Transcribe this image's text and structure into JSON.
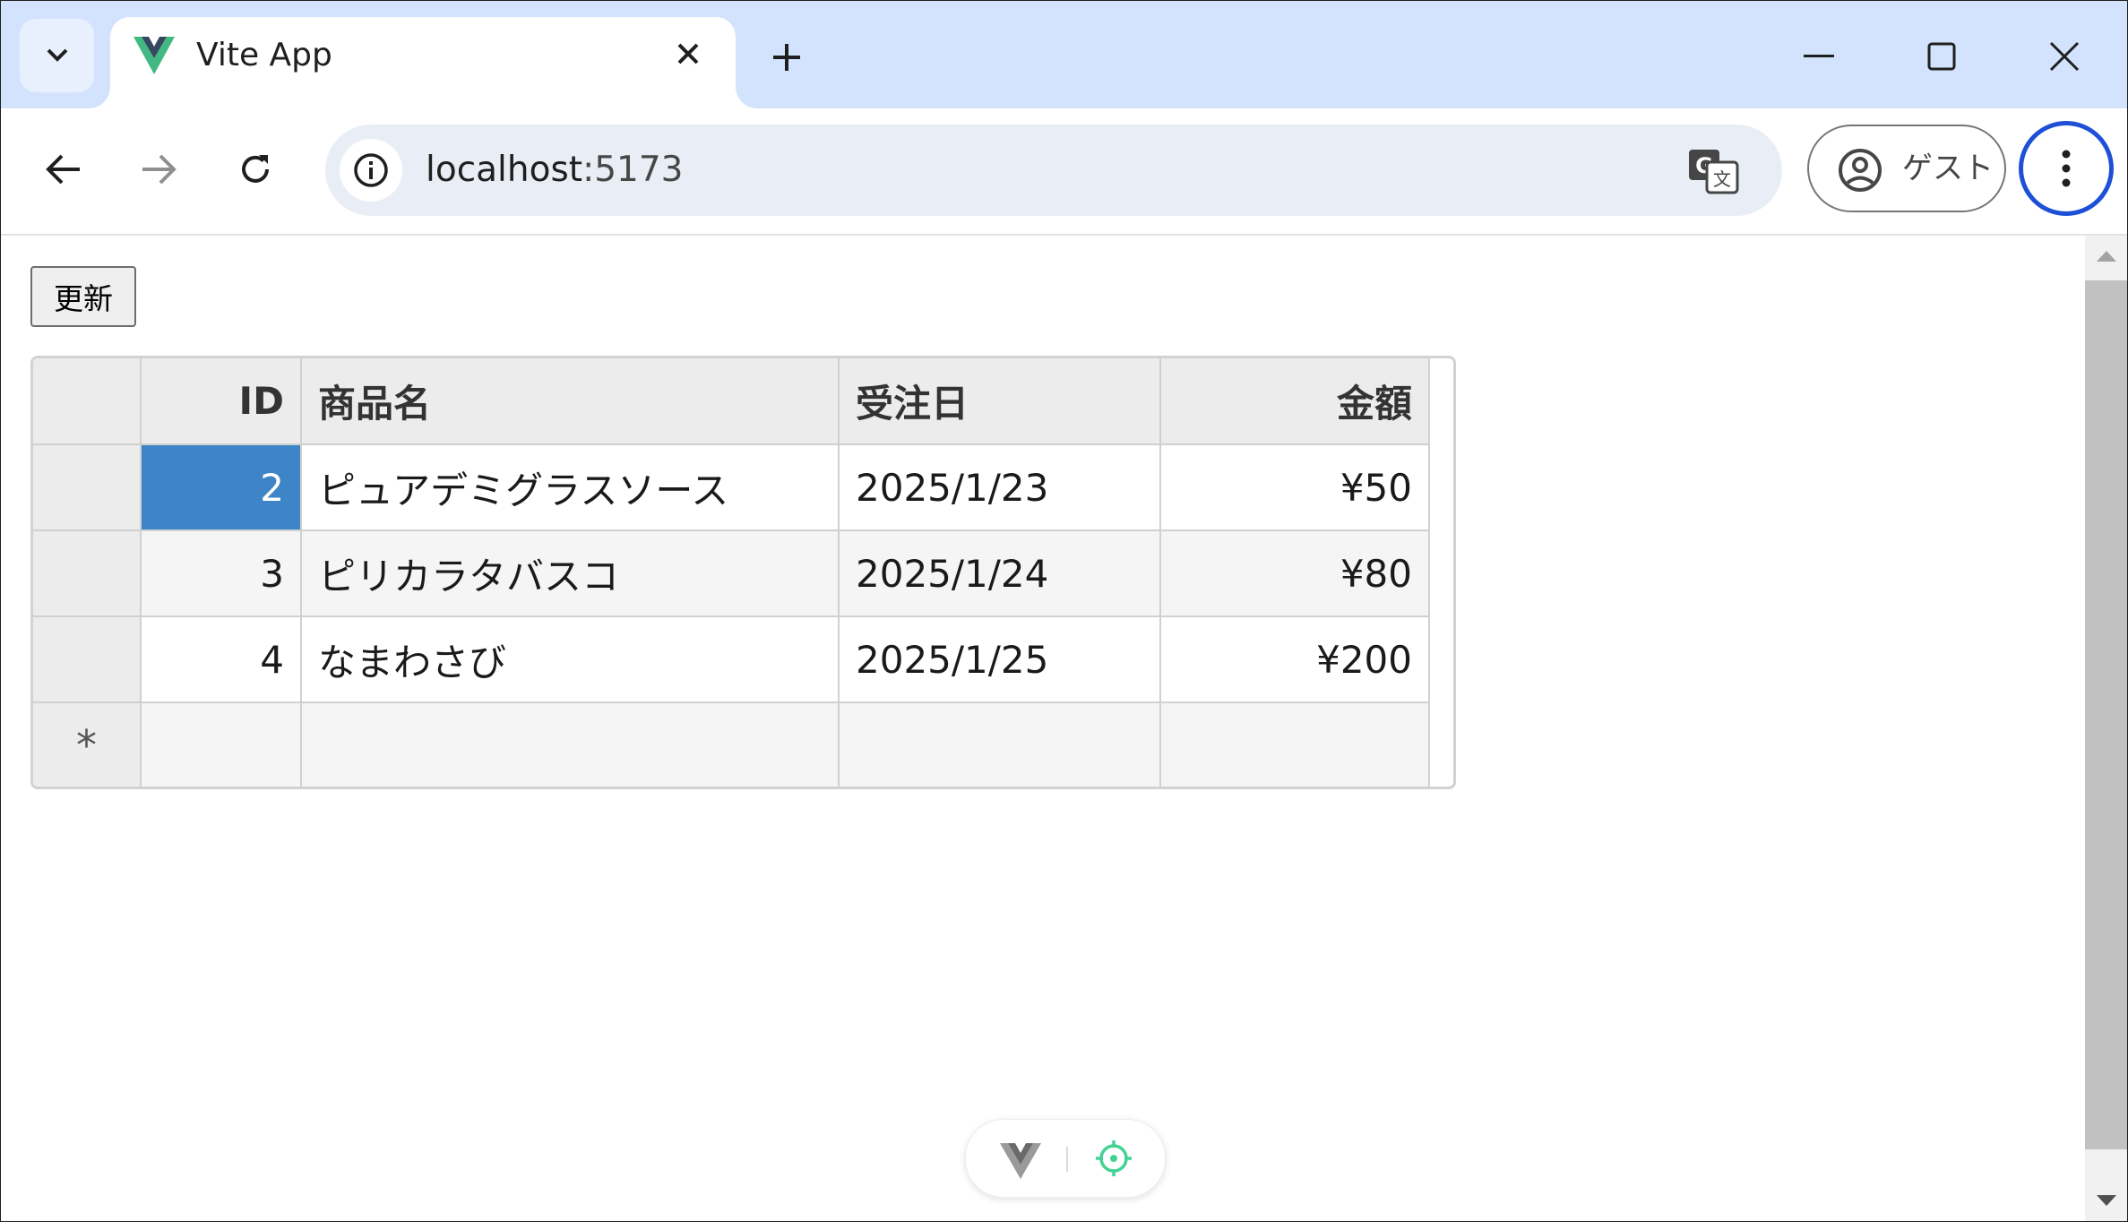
{
  "tab": {
    "title": "Vite App"
  },
  "address_bar": {
    "host": "localhost",
    "port": ":5173"
  },
  "profile": {
    "label": "ゲスト"
  },
  "page": {
    "refresh_label": "更新",
    "grid": {
      "columns": [
        "ID",
        "商品名",
        "受注日",
        "金額"
      ],
      "rows": [
        {
          "id": "2",
          "name": "ピュアデミグラスソース",
          "date": "2025/1/23",
          "amount": "¥50"
        },
        {
          "id": "3",
          "name": "ピリカラタバスコ",
          "date": "2025/1/24",
          "amount": "¥80"
        },
        {
          "id": "4",
          "name": "なまわさび",
          "date": "2025/1/25",
          "amount": "¥200"
        }
      ],
      "new_row_marker": "*"
    }
  },
  "colors": {
    "accent": "#1d4fd7",
    "tabstrip": "#d3e3fd",
    "selection": "#3d85c6",
    "vue_green": "#42b883"
  }
}
